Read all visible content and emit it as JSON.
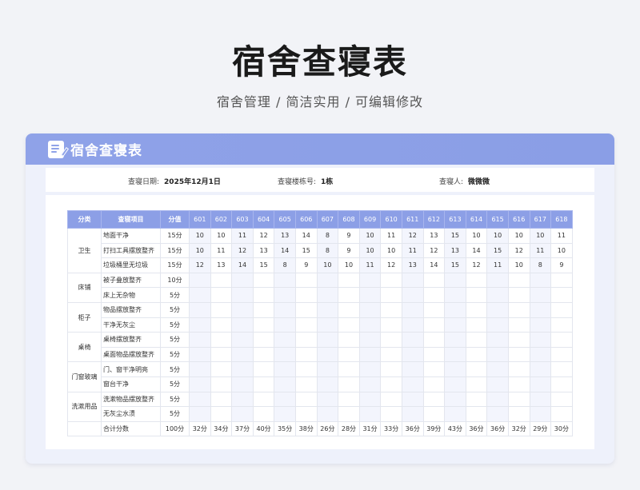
{
  "page": {
    "title": "宿舍查寝表",
    "subtitle": "宿舍管理 / 简洁实用 /  可编辑修改"
  },
  "card": {
    "title": "宿舍查寝表",
    "icon": "document-edit-icon"
  },
  "info": {
    "date_label": "查寝日期:",
    "date_value": "2025年12月1日",
    "building_label": "查寝楼栋号:",
    "building_value": "1栋",
    "inspector_label": "查寝人:",
    "inspector_value": "微微微"
  },
  "table": {
    "headers": {
      "category": "分类",
      "item": "查寝项目",
      "score": "分值"
    },
    "rooms": [
      "601",
      "602",
      "603",
      "604",
      "605",
      "606",
      "607",
      "608",
      "609",
      "610",
      "611",
      "612",
      "613",
      "614",
      "615",
      "616",
      "617",
      "618"
    ],
    "groups": [
      {
        "category": "卫生",
        "rows": [
          {
            "item": "地面干净",
            "score": "15分",
            "values": [
              "10",
              "10",
              "11",
              "12",
              "13",
              "14",
              "8",
              "9",
              "10",
              "11",
              "12",
              "13",
              "15",
              "10",
              "10",
              "10",
              "10",
              "11"
            ]
          },
          {
            "item": "打扫工具摆放整齐",
            "score": "15分",
            "values": [
              "10",
              "11",
              "12",
              "13",
              "14",
              "15",
              "8",
              "9",
              "10",
              "10",
              "11",
              "12",
              "13",
              "14",
              "15",
              "12",
              "11",
              "10"
            ]
          },
          {
            "item": "垃圾桶里无垃圾",
            "score": "15分",
            "values": [
              "12",
              "13",
              "14",
              "15",
              "8",
              "9",
              "10",
              "10",
              "11",
              "12",
              "13",
              "14",
              "15",
              "12",
              "11",
              "10",
              "8",
              "9"
            ]
          }
        ]
      },
      {
        "category": "床铺",
        "rows": [
          {
            "item": "被子叠放整齐",
            "score": "10分",
            "values": []
          },
          {
            "item": "床上无杂物",
            "score": "5分",
            "values": []
          }
        ]
      },
      {
        "category": "柜子",
        "rows": [
          {
            "item": "物品摆放整齐",
            "score": "5分",
            "values": []
          },
          {
            "item": "干净无灰尘",
            "score": "5分",
            "values": []
          }
        ]
      },
      {
        "category": "桌椅",
        "rows": [
          {
            "item": "桌椅摆放整齐",
            "score": "5分",
            "values": []
          },
          {
            "item": "桌面物品摆放整齐",
            "score": "5分",
            "values": []
          }
        ]
      },
      {
        "category": "门窗玻璃",
        "rows": [
          {
            "item": "门、窗干净明亮",
            "score": "5分",
            "values": []
          },
          {
            "item": "窗台干净",
            "score": "5分",
            "values": []
          }
        ]
      },
      {
        "category": "洗漱用品",
        "rows": [
          {
            "item": "洗漱物品摆放整齐",
            "score": "5分",
            "values": []
          },
          {
            "item": "无灰尘水渍",
            "score": "5分",
            "values": []
          }
        ]
      }
    ],
    "total": {
      "label": "合计分数",
      "score": "100分",
      "values": [
        "32分",
        "34分",
        "37分",
        "40分",
        "35分",
        "38分",
        "26分",
        "28分",
        "31分",
        "33分",
        "36分",
        "39分",
        "43分",
        "36分",
        "36分",
        "32分",
        "29分",
        "30分"
      ]
    }
  }
}
